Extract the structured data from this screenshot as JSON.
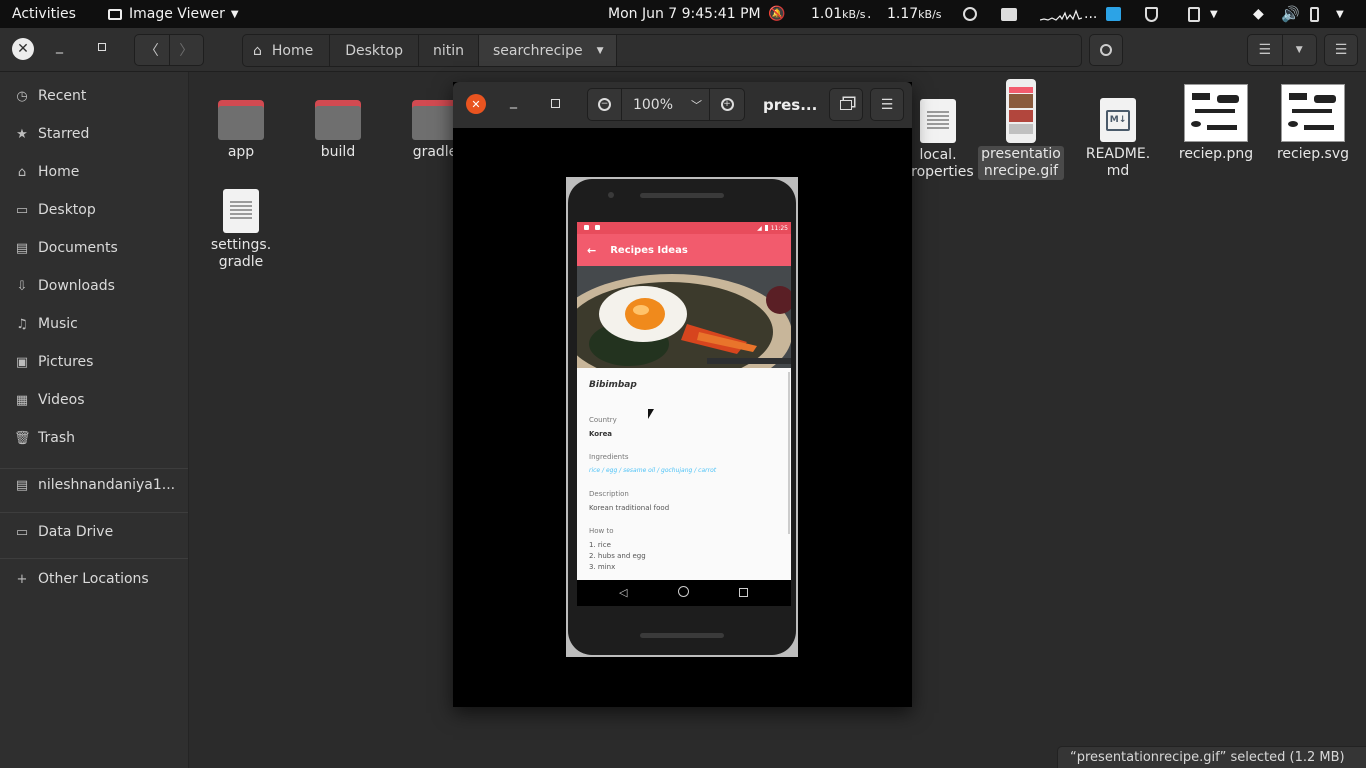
{
  "topbar": {
    "activities": "Activities",
    "app_menu": "Image Viewer",
    "clock": "Mon Jun 7  9:45:41 PM",
    "net_down": "1.01",
    "net_down_unit": "kB/s",
    "net_up": "1.17",
    "net_up_unit": "kB/s",
    "sep": ".",
    "overflow": "..."
  },
  "header": {
    "breadcrumbs": [
      "Home",
      "Desktop",
      "nitin",
      "searchrecipe"
    ]
  },
  "sidebar": {
    "items": [
      {
        "label": "Recent",
        "icon": "clock-icon"
      },
      {
        "label": "Starred",
        "icon": "star-icon"
      },
      {
        "label": "Home",
        "icon": "home-icon"
      },
      {
        "label": "Desktop",
        "icon": "desktop-icon"
      },
      {
        "label": "Documents",
        "icon": "documents-icon"
      },
      {
        "label": "Downloads",
        "icon": "downloads-icon"
      },
      {
        "label": "Music",
        "icon": "music-icon"
      },
      {
        "label": "Pictures",
        "icon": "pictures-icon"
      },
      {
        "label": "Videos",
        "icon": "videos-icon"
      },
      {
        "label": "Trash",
        "icon": "trash-icon"
      },
      {
        "label": "nileshnandaniya1...",
        "icon": "drive-icon"
      },
      {
        "label": "Data Drive",
        "icon": "drive-icon"
      },
      {
        "label": "Other Locations",
        "icon": "plus-icon"
      }
    ]
  },
  "files": {
    "app": "app",
    "build": "build",
    "gradle": "gradle",
    "settings_1": "settings.",
    "settings_2": "gradle",
    "local_1": "local.",
    "local_2": "properties",
    "gif_1": "presentatio",
    "gif_2": "nrecipe.gif",
    "readme_1": "README.",
    "readme_2": "md",
    "png": "reciep.png",
    "svg": "reciep.svg"
  },
  "status": {
    "text": "“presentationrecipe.gif” selected  (1.2 MB)"
  },
  "viewer": {
    "zoom": "100%",
    "title": "pres..."
  },
  "phone": {
    "time": "11:25",
    "appbar_title": "Recipes Ideas",
    "recipe_name": "Bibimbap",
    "country_label": "Country",
    "country": "Korea",
    "ingredients_label": "Ingredients",
    "ingredients": "rice / egg / sesame oil / gochujang / carrot",
    "description_label": "Description",
    "description": "Korean traditional food",
    "howto_label": "How to",
    "step1": "1. rice",
    "step2": "2. hubs and egg",
    "step3": "3. minx"
  },
  "colors": {
    "appbar": "#f25b6d",
    "close": "#e95420",
    "link": "#4fc3f7"
  }
}
